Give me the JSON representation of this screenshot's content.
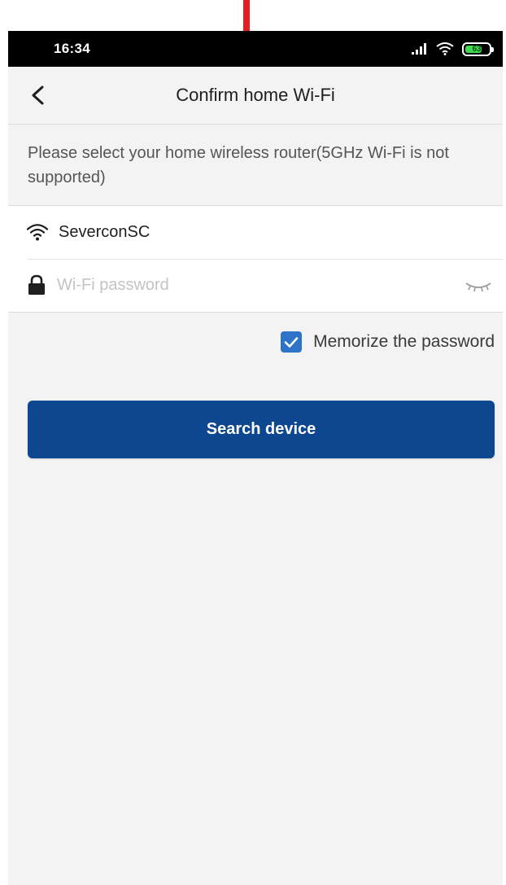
{
  "status_bar": {
    "time": "16:34",
    "battery_level": "63",
    "icons": [
      "signal-icon",
      "wifi-icon",
      "battery-icon"
    ]
  },
  "header": {
    "title": "Confirm home Wi-Fi",
    "back_icon": "chevron-left-icon"
  },
  "hint": {
    "text": "Please select your home wireless router(5GHz Wi-Fi is not supported)"
  },
  "wifi_form": {
    "ssid": "SeverconSC",
    "ssid_icon": "wifi-icon",
    "password_placeholder": "Wi-Fi password",
    "password_value": "",
    "password_icon": "lock-icon",
    "visibility_icon": "eye-closed-icon"
  },
  "memorize": {
    "label": "Memorize the password",
    "checked": true
  },
  "actions": {
    "search_label": "Search device"
  },
  "colors": {
    "primary_button": "#0c4790",
    "checkbox": "#2d73c8",
    "background": "#f3f3f3",
    "annotation_arrow": "#e41e1e"
  }
}
